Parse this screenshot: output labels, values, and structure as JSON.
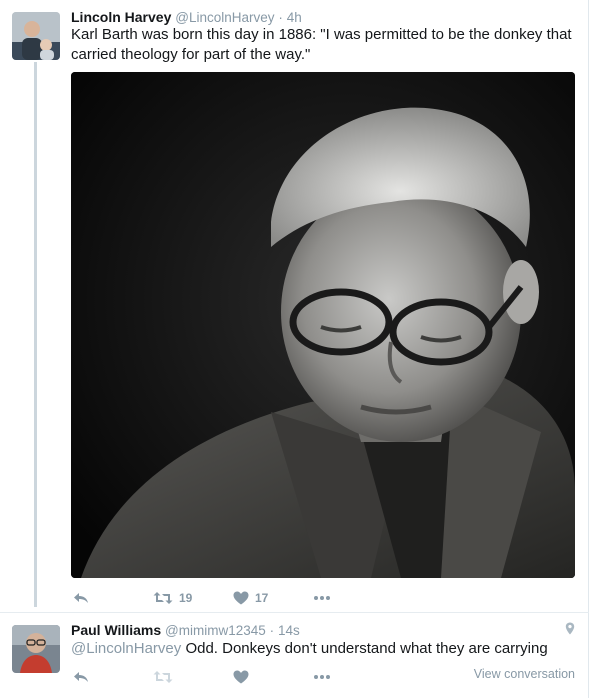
{
  "tweet1": {
    "name": "Lincoln Harvey",
    "handle": "@LincolnHarvey",
    "separator": "·",
    "time": "4h",
    "text_line1": "Karl Barth was born this day in 1886: \"I was permitted to be the donkey that",
    "text_line2": "carried theology for part of the way.\"",
    "retweets": "19",
    "likes": "17"
  },
  "tweet2": {
    "name": "Paul Williams",
    "handle": "@mimimw12345",
    "separator": "·",
    "time": "14s",
    "mention": "@LincolnHarvey",
    "text": " Odd. Donkeys don't understand what they are carrying",
    "view_conversation": "View conversation"
  },
  "icons": {
    "reply": "reply-icon",
    "retweet": "retweet-icon",
    "like": "heart-icon",
    "more": "more-icon",
    "location": "location-pin-icon"
  },
  "colors": {
    "muted": "#8899a6",
    "thread_line": "#ccd6dd"
  }
}
